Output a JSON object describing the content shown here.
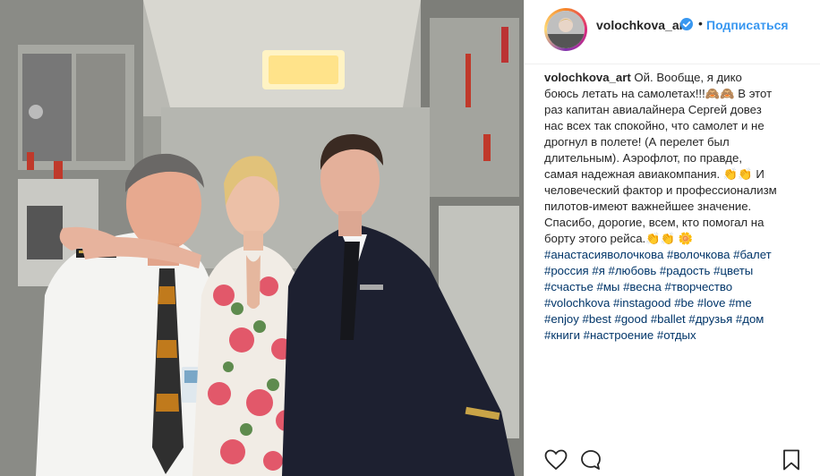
{
  "post": {
    "username": "volochkova_art",
    "separator": "•",
    "follow_label": "Подписаться",
    "caption": {
      "username": "volochkova_art",
      "text": "Ой. Вообще, я дико боюсь летать на самолетах!!!🙈🙈 В этот раз капитан авиалайнера Сергей довез нас всех так спокойно, что самолет и не дрогнул в полете! (А перелет был длительным). Аэрофлот, по правде, самая надежная авиакомпания. 👏👏 И человеческий фактор и профессионализм пилотов-имеют важнейшее значение. Спасибо, дорогие, всем, кто помогал на борту этого рейса.👏👏 🌼",
      "hashtags": [
        "#анастасияволочкова",
        "#волочкова",
        "#балет",
        "#россия",
        "#я",
        "#любовь",
        "#радость",
        "#цветы",
        "#счастье",
        "#мы",
        "#весна",
        "#творчество",
        "#volochkova",
        "#instagood",
        "#be",
        "#love",
        "#me",
        "#enjoy",
        "#best",
        "#good",
        "#ballet",
        "#друзья",
        "#дом",
        "#книги",
        "#настроение",
        "#отдых"
      ]
    },
    "icons": {
      "verified": "verified-badge-icon",
      "like": "heart-icon",
      "comment": "comment-icon",
      "save": "bookmark-icon"
    },
    "colors": {
      "link": "#3897f0",
      "hashtag": "#003569",
      "text": "#262626",
      "border": "#efefef"
    }
  }
}
